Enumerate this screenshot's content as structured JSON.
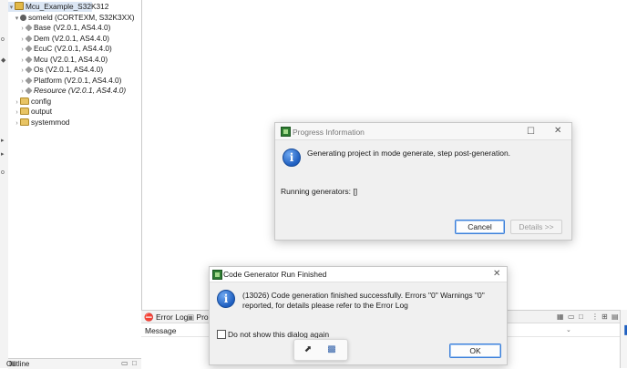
{
  "explorer": {
    "items": [
      {
        "label": "Mcu_Example_S32K312",
        "level": 0,
        "icon": "project-icon",
        "twisty": "▾"
      },
      {
        "label": "someld (CORTEXM, S32K3XX)",
        "level": 1,
        "icon": "cpu-icon",
        "twisty": "▾"
      },
      {
        "label": "Base (V2.0.1, AS4.4.0)",
        "level": 2,
        "icon": "module-icon",
        "twisty": "›"
      },
      {
        "label": "Dem (V2.0.1, AS4.4.0)",
        "level": 2,
        "icon": "module-icon",
        "twisty": "›"
      },
      {
        "label": "EcuC (V2.0.1, AS4.4.0)",
        "level": 2,
        "icon": "module-icon",
        "twisty": "›"
      },
      {
        "label": "Mcu (V2.0.1, AS4.4.0)",
        "level": 2,
        "icon": "module-icon",
        "twisty": "›"
      },
      {
        "label": "Os (V2.0.1, AS4.4.0)",
        "level": 2,
        "icon": "module-icon",
        "twisty": "›"
      },
      {
        "label": "Platform (V2.0.1, AS4.4.0)",
        "level": 2,
        "icon": "module-icon",
        "twisty": "›"
      },
      {
        "label": "Resource (V2.0.1, AS4.4.0)",
        "level": 2,
        "icon": "module-icon",
        "twisty": "›",
        "italic": true
      },
      {
        "label": "config",
        "level": 1,
        "icon": "folder-icon",
        "twisty": "›"
      },
      {
        "label": "output",
        "level": 1,
        "icon": "folder-icon",
        "twisty": "›"
      },
      {
        "label": "systemmod",
        "level": 1,
        "icon": "folder-icon",
        "twisty": "›"
      }
    ],
    "outline_tab": "Outline"
  },
  "bottom_panel": {
    "tabs": [
      "Error Log",
      "Prob"
    ],
    "column_message": "Message"
  },
  "progress_dialog": {
    "title": "Progress Information",
    "message": "Generating project in mode generate, step post-generation.",
    "status": "Running generators: []",
    "cancel_label": "Cancel",
    "details_label": "Details >>"
  },
  "codegen_dialog": {
    "title": "Code Generator Run Finished",
    "message": "(13026) Code generation finished successfully. Errors \"0\" Warnings \"0\" reported, for details please refer to the Error Log",
    "checkbox_label": "Do not show this dialog again",
    "ok_label": "OK"
  },
  "colors": {
    "info_blue": "#1f5fc0",
    "selection": "#dbe6f4",
    "primary_border": "#3c7fd9"
  }
}
